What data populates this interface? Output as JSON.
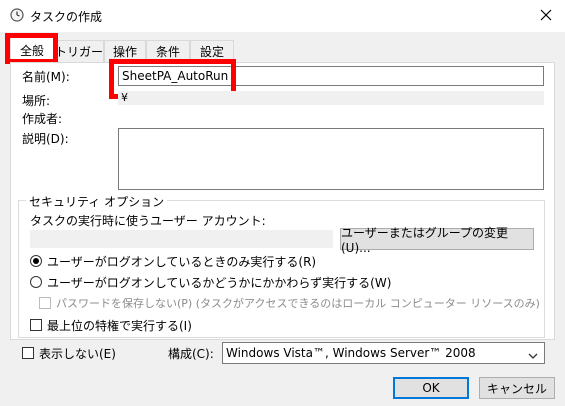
{
  "window": {
    "title": "タスクの作成",
    "clock_icon": "clock-icon",
    "close_icon": "close-icon"
  },
  "tabs": [
    {
      "label": "全般",
      "active": true
    },
    {
      "label": "トリガー",
      "active": false
    },
    {
      "label": "操作",
      "active": false
    },
    {
      "label": "条件",
      "active": false
    },
    {
      "label": "設定",
      "active": false
    }
  ],
  "general": {
    "name_label": "名前(M):",
    "name_value": "SheetPA_AutoRun",
    "location_label": "場所:",
    "location_value": "¥",
    "author_label": "作成者:",
    "description_label": "説明(D):"
  },
  "security": {
    "group_label": "セキュリティ オプション",
    "run_account_label": "タスクの実行時に使うユーザー アカウント:",
    "change_button": "ユーザーまたはグループの変更(U)...",
    "radio_logged_on": "ユーザーがログオンしているときのみ実行する(R)",
    "radio_whether": "ユーザーがログオンしているかどうかにかかわらず実行する(W)",
    "no_password": "パスワードを保存しない(P) (タスクがアクセスできるのはローカル コンピューター リソースのみ)",
    "highest_priv": "最上位の特権で実行する(I)"
  },
  "footer": {
    "hidden_label": "表示しない(E)",
    "config_label": "構成(C):",
    "config_value": "Windows Vista™, Windows Server™ 2008",
    "ok": "OK",
    "cancel": "キャンセル"
  },
  "colors": {
    "highlight": "#ff0000",
    "accent": "#0078d7"
  }
}
